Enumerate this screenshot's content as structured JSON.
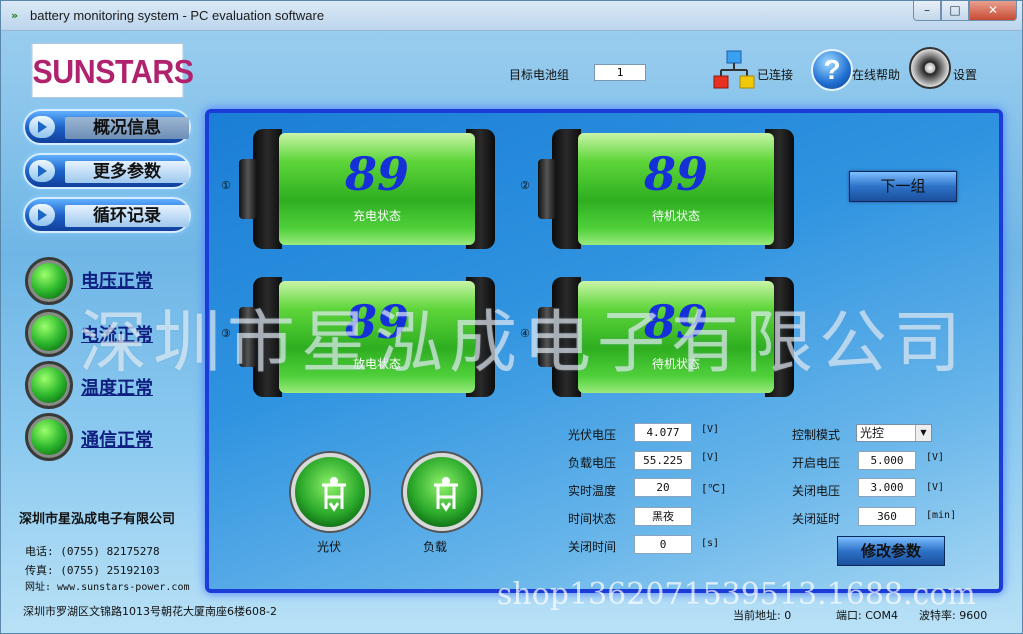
{
  "window": {
    "title": "battery monitoring system - PC evaluation software",
    "min": "–",
    "max": "□",
    "close": "✕"
  },
  "logo": "SUNSTARS",
  "nav": [
    {
      "label": "概况信息"
    },
    {
      "label": "更多参数"
    },
    {
      "label": "循环记录"
    }
  ],
  "status_lights": [
    {
      "label": "电压正常"
    },
    {
      "label": "电流正常"
    },
    {
      "label": "温度正常"
    },
    {
      "label": "通信正常"
    }
  ],
  "company": {
    "name": "深圳市星泓成电子有限公司",
    "phone": "电话: (0755) 82175278",
    "fax": "传真: (0755) 25192103",
    "web": "网址: www.sunstars-power.com",
    "address": "深圳市罗湖区文锦路1013号朝花大厦南座6楼608-2"
  },
  "header": {
    "target_label": "目标电池组",
    "target_value": "1",
    "connect_label": "已连接",
    "help_label": "在线帮助",
    "settings_label": "设置"
  },
  "batteries": [
    {
      "index": "①",
      "value": "89",
      "status": "充电状态"
    },
    {
      "index": "②",
      "value": "89",
      "status": "待机状态"
    },
    {
      "index": "③",
      "value": "89",
      "status": "放电状态"
    },
    {
      "index": "④",
      "value": "89",
      "status": "待机状态"
    }
  ],
  "next_group": "下一组",
  "params_left": [
    {
      "label": "光伏电压",
      "value": "4.077",
      "unit": "[V]"
    },
    {
      "label": "负载电压",
      "value": "55.225",
      "unit": "[V]"
    },
    {
      "label": "实时温度",
      "value": "20",
      "unit": "[℃]"
    },
    {
      "label": "时间状态",
      "value": "黑夜",
      "unit": ""
    },
    {
      "label": "关闭时间",
      "value": "0",
      "unit": "[s]"
    }
  ],
  "params_right": [
    {
      "label": "控制模式",
      "value": "光控",
      "unit": ""
    },
    {
      "label": "开启电压",
      "value": "5.000",
      "unit": "[V]"
    },
    {
      "label": "关闭电压",
      "value": "3.000",
      "unit": "[V]"
    },
    {
      "label": "关闭延时",
      "value": "360",
      "unit": "[min]"
    }
  ],
  "modify_button": "修改参数",
  "io": {
    "pv_label": "光伏",
    "load_label": "负载"
  },
  "watermark": "深圳市星泓成电子有限公司",
  "shop_watermark": "shop1362071539513.1688.com",
  "status_bar": {
    "address": "当前地址: 0",
    "port": "端口: COM4",
    "baud": "波特率: 9600"
  }
}
